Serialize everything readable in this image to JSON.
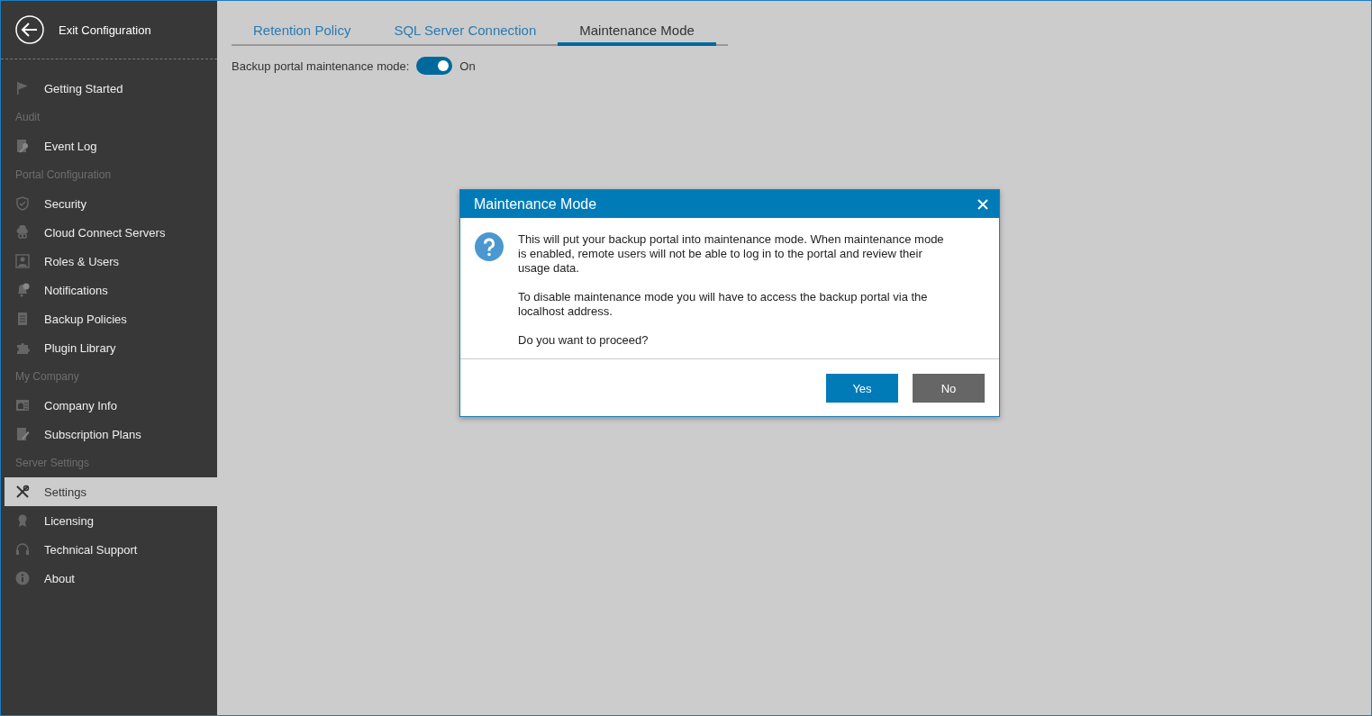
{
  "sidebar": {
    "exit": {
      "label": "Exit Configuration"
    },
    "items": [
      {
        "kind": "item",
        "label": "Getting Started",
        "selected": false
      },
      {
        "kind": "header",
        "label": "Audit"
      },
      {
        "kind": "item",
        "label": "Event Log",
        "selected": false
      },
      {
        "kind": "header",
        "label": "Portal Configuration"
      },
      {
        "kind": "item",
        "label": "Security",
        "selected": false
      },
      {
        "kind": "item",
        "label": "Cloud Connect Servers",
        "selected": false
      },
      {
        "kind": "item",
        "label": "Roles & Users",
        "selected": false
      },
      {
        "kind": "item",
        "label": "Notifications",
        "selected": false
      },
      {
        "kind": "item",
        "label": "Backup Policies",
        "selected": false
      },
      {
        "kind": "item",
        "label": "Plugin Library",
        "selected": false
      },
      {
        "kind": "header",
        "label": "My Company"
      },
      {
        "kind": "item",
        "label": "Company Info",
        "selected": false
      },
      {
        "kind": "item",
        "label": "Subscription Plans",
        "selected": false
      },
      {
        "kind": "header",
        "label": "Server Settings"
      },
      {
        "kind": "item",
        "label": "Settings",
        "selected": true
      },
      {
        "kind": "item",
        "label": "Licensing",
        "selected": false
      },
      {
        "kind": "item",
        "label": "Technical Support",
        "selected": false
      },
      {
        "kind": "item",
        "label": "About",
        "selected": false
      }
    ]
  },
  "tabs": [
    {
      "label": "Retention Policy",
      "selected": false
    },
    {
      "label": "SQL Server Connection",
      "selected": false
    },
    {
      "label": "Maintenance Mode",
      "selected": true
    }
  ],
  "maintenance_toggle": {
    "label": "Backup portal maintenance mode:",
    "on": true,
    "state_text": "On"
  },
  "dialog": {
    "title": "Maintenance Mode",
    "paragraphs": [
      "This will put your backup portal into maintenance mode. When maintenance mode is enabled, remote users will not be able to log in to the portal and review their usage data.",
      "To disable maintenance mode you will have to access the backup portal via the localhost address.",
      "Do you want to proceed?"
    ],
    "buttons": [
      {
        "kind": "primary",
        "label": "Yes"
      },
      {
        "kind": "secondary",
        "label": "No"
      }
    ]
  }
}
